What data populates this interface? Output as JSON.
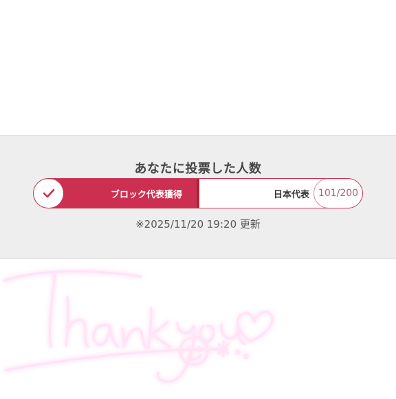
{
  "vote_panel": {
    "title": "あなたに投票した人数",
    "current_rank": "ブロック代表獲得",
    "next_rank": "日本代表",
    "votes": 101,
    "votes_goal": 200,
    "votes_text": "101/200",
    "updated": "※2025/11/20 19:20 更新",
    "accent_color": "#cc2f4f"
  },
  "decoration": {
    "text": "Thank you",
    "icons": [
      "heart-icon",
      "smiley-icon",
      "sparkle-icon"
    ],
    "glow_color": "#ff7fd0"
  }
}
